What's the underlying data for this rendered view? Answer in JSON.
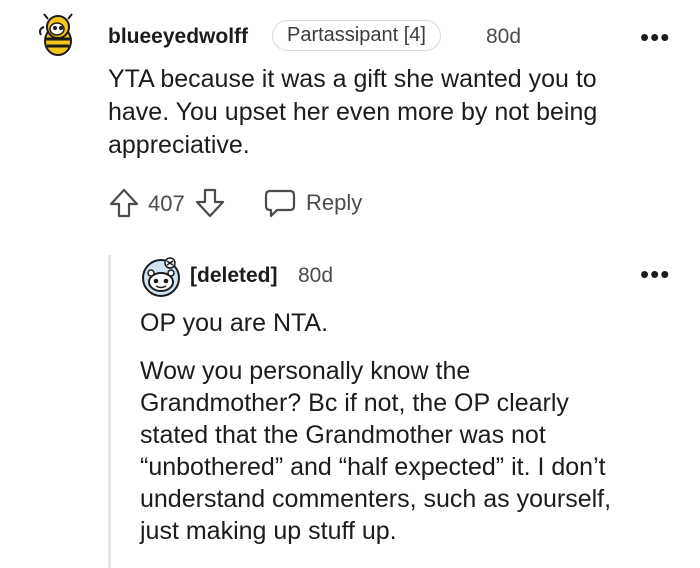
{
  "comment": {
    "username": "blueeyedwolff",
    "flair": "Partassipant [4]",
    "age": "80d",
    "more": "•••",
    "body": "YTA because it was a gift she wanted you to have. You upset her even more by not being appreciative.",
    "body_lines": [
      "YTA because it was a gift she wanted you to",
      "have. You upset her even more by not being",
      "appreciative."
    ],
    "votes": "407",
    "reply_label": "Reply",
    "icons": {
      "avatar": "bee-avatar-icon",
      "upvote": "arrow-up-icon",
      "downvote": "arrow-down-icon",
      "reply": "speech-bubble-icon",
      "more": "more-dots-icon"
    }
  },
  "reply": {
    "username": "[deleted]",
    "age": "80d",
    "more": "•••",
    "paragraph1": "OP you are NTA.",
    "paragraph2_lines": [
      "Wow you personally know the",
      "Grandmother? Bc if not, the OP clearly",
      "stated that the Grandmother was not",
      "“unbothered” and “half expected” it. I don’t",
      "understand commenters, such as yourself,",
      "just making up stuff up."
    ],
    "icons": {
      "avatar": "snoo-avatar-icon",
      "more": "more-dots-icon"
    }
  },
  "colors": {
    "text": "#1c1c1c",
    "muted": "#4b4b4b",
    "thread_line": "#e3e6e8"
  }
}
